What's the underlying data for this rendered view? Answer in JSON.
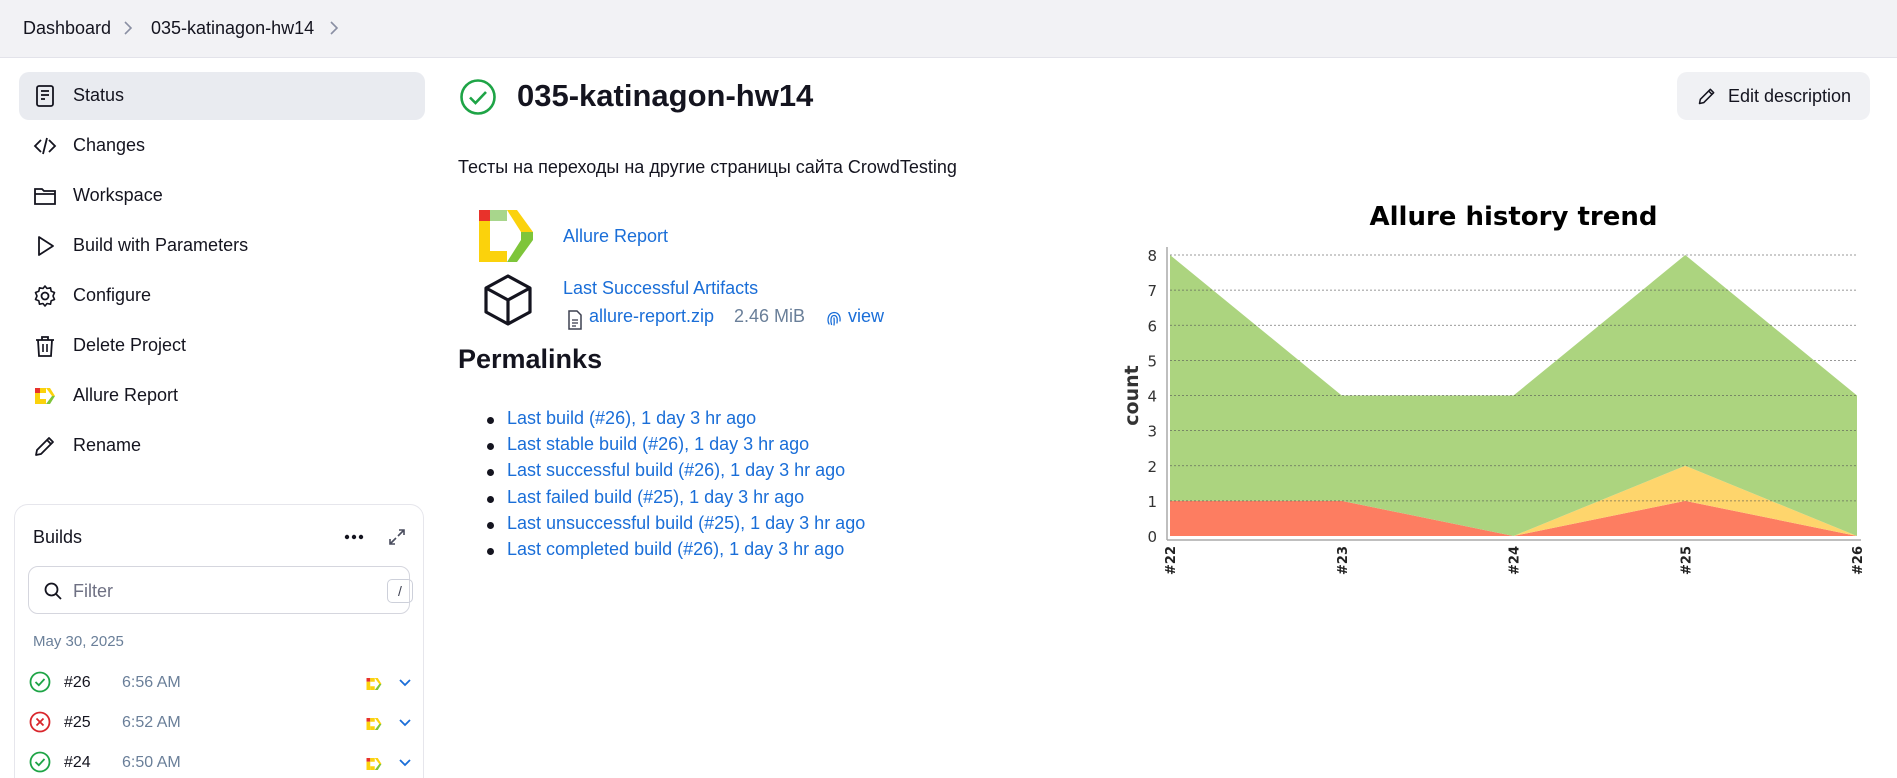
{
  "breadcrumb": {
    "items": [
      "Dashboard",
      "035-katinagon-hw14"
    ]
  },
  "sidebar": {
    "items": [
      {
        "label": "Status",
        "icon": "status-document-icon",
        "active": true
      },
      {
        "label": "Changes",
        "icon": "code-icon",
        "active": false
      },
      {
        "label": "Workspace",
        "icon": "folder-icon",
        "active": false
      },
      {
        "label": "Build with Parameters",
        "icon": "play-icon",
        "active": false
      },
      {
        "label": "Configure",
        "icon": "gear-icon",
        "active": false
      },
      {
        "label": "Delete Project",
        "icon": "trash-icon",
        "active": false
      },
      {
        "label": "Allure Report",
        "icon": "allure-logo-icon",
        "active": false
      },
      {
        "label": "Rename",
        "icon": "pencil-icon",
        "active": false
      }
    ]
  },
  "builds": {
    "title": "Builds",
    "filter_placeholder": "Filter",
    "filter_shortcut": "/",
    "date": "May 30, 2025",
    "rows": [
      {
        "number": "#26",
        "time": "6:56 AM",
        "status": "success"
      },
      {
        "number": "#25",
        "time": "6:52 AM",
        "status": "failed"
      },
      {
        "number": "#24",
        "time": "6:50 AM",
        "status": "success"
      }
    ]
  },
  "main": {
    "title": "035-katinagon-hw14",
    "edit_label": "Edit description",
    "description": "Тесты на переходы на другие страницы сайта CrowdTesting",
    "allure_link": "Allure Report",
    "artifacts_link": "Last Successful Artifacts",
    "artifact_file": "allure-report.zip",
    "artifact_size": "2.46 MiB",
    "artifact_view": "view",
    "permalinks_title": "Permalinks",
    "permalinks": [
      "Last build (#26), 1 day 3 hr ago",
      "Last stable build (#26), 1 day 3 hr ago",
      "Last successful build (#26), 1 day 3 hr ago",
      "Last failed build (#25), 1 day 3 hr ago",
      "Last unsuccessful build (#25), 1 day 3 hr ago",
      "Last completed build (#26), 1 day 3 hr ago"
    ]
  },
  "colors": {
    "success": "#1ea446",
    "failed": "#d9262c",
    "link": "#1a6ed8",
    "passed_area": "#acd47f",
    "broken_area": "#fed56c",
    "failed_area": "#fd7d61"
  },
  "chart_data": {
    "type": "area",
    "title": "Allure history trend",
    "ylabel": "count",
    "categories": [
      "#22",
      "#23",
      "#24",
      "#25",
      "#26"
    ],
    "ylim": [
      0,
      8
    ],
    "yticks": [
      0,
      1,
      2,
      3,
      4,
      5,
      6,
      7,
      8
    ],
    "grid": true,
    "stacked": true,
    "series": [
      {
        "values": [
          1,
          1,
          0,
          1,
          0
        ],
        "color": "#fd7d61"
      },
      {
        "values": [
          0,
          0,
          0,
          1,
          0
        ],
        "color": "#fed56c"
      },
      {
        "values": [
          7,
          3,
          4,
          6,
          4
        ],
        "color": "#acd47f"
      }
    ]
  }
}
